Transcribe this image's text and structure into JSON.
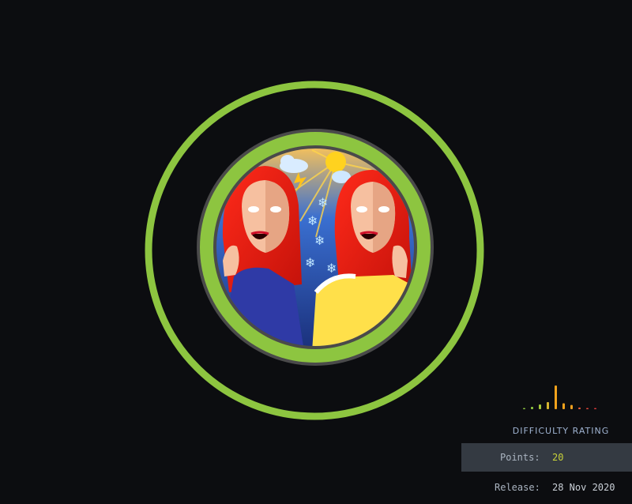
{
  "machine": {
    "avatar_icon": "twin-women-weather-avatar-icon",
    "ring_color": "#8dc540"
  },
  "difficulty": {
    "label": "DIFFICULTY RATING",
    "bar_levels": [
      0.05,
      0.1,
      0.2,
      0.3,
      1.0,
      0.25,
      0.18,
      0.07,
      0.05,
      0.04
    ],
    "bar_colors": [
      "#8dc540",
      "#8dc540",
      "#a7c93a",
      "#d6b52f",
      "#f2a21c",
      "#f2a21c",
      "#f0a020",
      "#e85c3a",
      "#e8463a",
      "#e03c3c"
    ]
  },
  "info": {
    "points_label": "Points:",
    "points_value": "20",
    "release_label": "Release:",
    "release_value": "28 Nov 2020"
  }
}
